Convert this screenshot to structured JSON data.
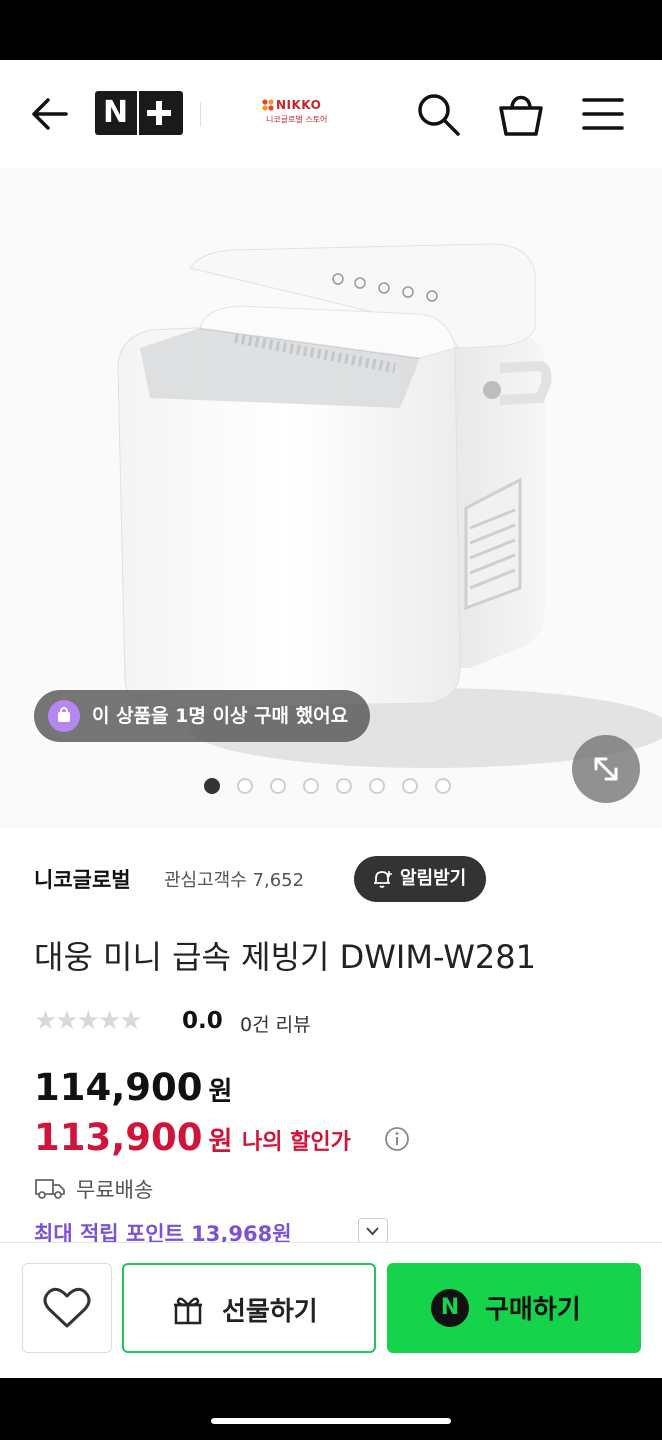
{
  "header": {
    "nplus_letter": "N",
    "store_name": "NIKKO",
    "store_sub": "니코글로벌 스토어"
  },
  "gallery": {
    "purchase_badge": "이 상품을 1명 이상 구매 했어요",
    "image_count": 8,
    "active_index": 0
  },
  "seller": {
    "name": "니코글로벌",
    "followers_label": "관심고객수 7,652",
    "alarm_button": "알림받기"
  },
  "product": {
    "title": "대웅 미니 급속 제빙기 DWIM-W281",
    "stars": "★★★★★",
    "rating": "0.0",
    "review_count": "0건 리뷰",
    "price_original": "114,900",
    "price_sale": "113,900",
    "currency": "원",
    "discount_label": "나의 할인가",
    "delivery": "무료배송",
    "points": "최대 적립 포인트 13,968원"
  },
  "bottom_bar": {
    "gift_label": "선물하기",
    "buy_label": "구매하기",
    "buy_icon": "N",
    "accent_green": "#16d34c"
  },
  "colors": {
    "sale_red": "#d0143a",
    "points_purple": "#7b52d6"
  }
}
